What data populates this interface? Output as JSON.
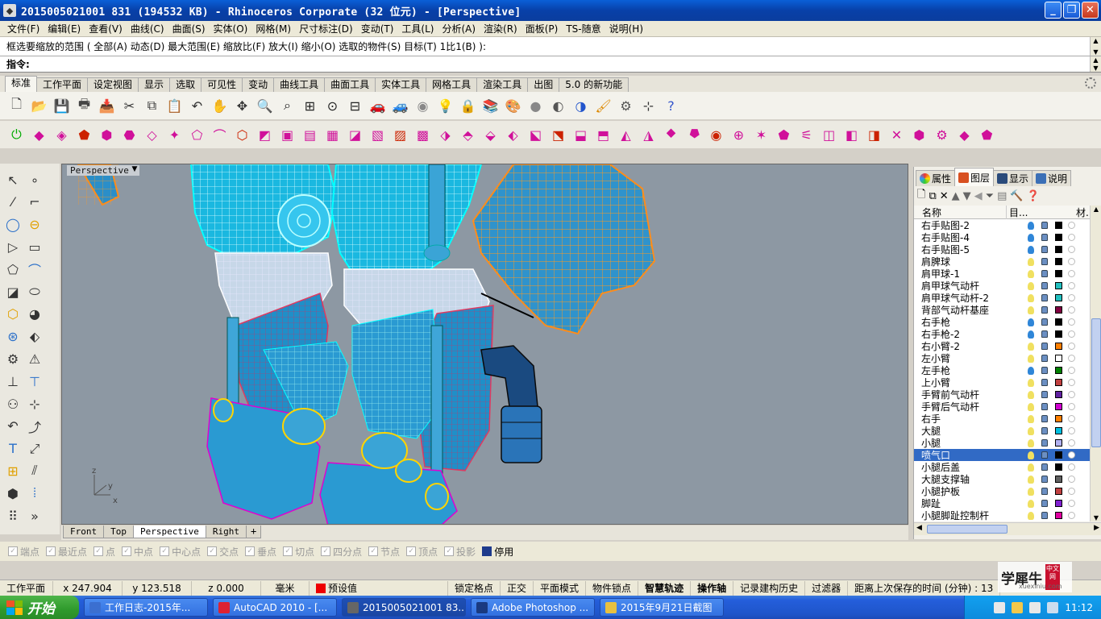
{
  "window": {
    "title": "2015005021001 831 (194532 KB) - Rhinoceros Corporate (32 位元) - [Perspective]",
    "buttons": [
      "_",
      "❐",
      "✕"
    ]
  },
  "menu": [
    "文件(F)",
    "编辑(E)",
    "查看(V)",
    "曲线(C)",
    "曲面(S)",
    "实体(O)",
    "网格(M)",
    "尺寸标注(D)",
    "变动(T)",
    "工具(L)",
    "分析(A)",
    "渲染(R)",
    "面板(P)",
    "TS-随意",
    "说明(H)"
  ],
  "command": {
    "history": "框选要缩放的范围 ( 全部(A)  动态(D)  最大范围(E)  缩放比(F)  放大(I)  缩小(O)  选取的物件(S)  目标(T)  1比1(B) ):",
    "prompt": "指令:",
    "value": ""
  },
  "toolbar_tabs": [
    "标准",
    "工作平面",
    "设定视图",
    "显示",
    "选取",
    "可见性",
    "变动",
    "曲线工具",
    "曲面工具",
    "实体工具",
    "网格工具",
    "渲染工具",
    "出图",
    "5.0 的新功能"
  ],
  "toolbar_tabs_active": 0,
  "toolbar_row1_icons": [
    "new-icon",
    "open-icon",
    "save-icon",
    "print-icon",
    "import-icon",
    "cut-icon",
    "copy-icon",
    "paste-icon",
    "undo-icon",
    "pan-icon",
    "rotate-view-icon",
    "zoom-icon",
    "zoom-window-icon",
    "zoom-extents-icon",
    "zoom-selected-icon",
    "viewports-icon",
    "car-icon",
    "car-ghost-icon",
    "cplane-icon",
    "light-icon",
    "lock-icon",
    "layer-icon",
    "color-wheel-icon",
    "shade-icon",
    "render-icon",
    "material-icon",
    "select-icon",
    "options-icon",
    "snap-icon",
    "help-icon"
  ],
  "toolbar_row2_count": 44,
  "left_toolbar_count": 32,
  "viewport": {
    "label": "Perspective",
    "axis_labels": [
      "z",
      "y",
      "x"
    ],
    "tabs": [
      "Front",
      "Top",
      "Perspective",
      "Right",
      "+"
    ],
    "active_tab": 2
  },
  "panel": {
    "tabs": [
      "属性",
      "图层",
      "显示",
      "说明"
    ],
    "active_tab": 1,
    "columns": [
      "名称",
      "目...",
      "材..."
    ],
    "layers": [
      {
        "name": "右手贴图-2",
        "color": "#000000",
        "bulb": "#2f86d8"
      },
      {
        "name": "右手贴图-4",
        "color": "#000000",
        "bulb": "#2f86d8"
      },
      {
        "name": "右手贴图-5",
        "color": "#000000",
        "bulb": "#2f86d8"
      },
      {
        "name": "肩脾球",
        "color": "#000000",
        "bulb": "#f0e060"
      },
      {
        "name": "肩甲球-1",
        "color": "#000000",
        "bulb": "#f0e060"
      },
      {
        "name": "肩甲球气动杆",
        "color": "#22c0c0",
        "bulb": "#f0e060"
      },
      {
        "name": "肩甲球气动杆-2",
        "color": "#22c0c0",
        "bulb": "#f0e060"
      },
      {
        "name": "背部气动杆基座",
        "color": "#800040",
        "bulb": "#f0e060"
      },
      {
        "name": "右手枪",
        "color": "#000000",
        "bulb": "#2f86d8"
      },
      {
        "name": "右手枪-2",
        "color": "#000000",
        "bulb": "#2f86d8"
      },
      {
        "name": "右小臂-2",
        "color": "#ff8000",
        "bulb": "#f0e060"
      },
      {
        "name": "左小臂",
        "color": "#ffffff",
        "bulb": "#f0e060"
      },
      {
        "name": "左手枪",
        "color": "#008000",
        "bulb": "#2f86d8"
      },
      {
        "name": "上小臂",
        "color": "#c04040",
        "bulb": "#f0e060"
      },
      {
        "name": "手臂前气动杆",
        "color": "#6020a0",
        "bulb": "#f0e060"
      },
      {
        "name": "手臂后气动杆",
        "color": "#d000d0",
        "bulb": "#f0e060"
      },
      {
        "name": "右手",
        "color": "#ff8000",
        "bulb": "#f0e060"
      },
      {
        "name": "大腿",
        "color": "#00c0e0",
        "bulb": "#f0e060"
      },
      {
        "name": "小腿",
        "color": "#b0b0f0",
        "bulb": "#f0e060"
      },
      {
        "name": "喷气口",
        "color": "#000000",
        "bulb": "#f0e060",
        "selected": true
      },
      {
        "name": "小腿后盖",
        "color": "#000000",
        "bulb": "#f0e060"
      },
      {
        "name": "大腿支撑轴",
        "color": "#606060",
        "bulb": "#f0e060"
      },
      {
        "name": "小腿护板",
        "color": "#c04040",
        "bulb": "#f0e060"
      },
      {
        "name": "脚趾",
        "color": "#8020d0",
        "bulb": "#f0e060"
      },
      {
        "name": "小腿脚趾控制杆",
        "color": "#e000a0",
        "bulb": "#f0e060"
      }
    ]
  },
  "osnap": [
    {
      "label": "端点",
      "on": false
    },
    {
      "label": "最近点",
      "on": false
    },
    {
      "label": "点",
      "on": false
    },
    {
      "label": "中点",
      "on": false
    },
    {
      "label": "中心点",
      "on": false
    },
    {
      "label": "交点",
      "on": false
    },
    {
      "label": "垂点",
      "on": false
    },
    {
      "label": "切点",
      "on": false
    },
    {
      "label": "四分点",
      "on": false
    },
    {
      "label": "节点",
      "on": false
    },
    {
      "label": "顶点",
      "on": false
    },
    {
      "label": "投影",
      "on": false
    },
    {
      "label": "停用",
      "on": true
    }
  ],
  "status": {
    "cplane": "工作平面",
    "x": "x 247.904",
    "y": "y 123.518",
    "z": "z 0.000",
    "unit": "毫米",
    "layer": "预设值",
    "items": [
      "锁定格点",
      "正交",
      "平面模式",
      "物件锁点",
      "智慧轨迹",
      "操作轴",
      "记录建构历史",
      "过滤器",
      "距离上次保存的时间 (分钟) : 13"
    ],
    "bold_items": [
      "智慧轨迹",
      "操作轴"
    ]
  },
  "watermark": {
    "text": "学犀牛",
    "badge": "中文网",
    "url": "xuexiniu.com"
  },
  "taskbar": {
    "start": "开始",
    "tasks": [
      {
        "label": "工作日志-2015年...",
        "color": "#3b6fd0"
      },
      {
        "label": "AutoCAD 2010 - [...",
        "color": "#d23"
      },
      {
        "label": "2015005021001 83...",
        "color": "#666",
        "active": true
      },
      {
        "label": "Adobe Photoshop ...",
        "color": "#1a3a80"
      },
      {
        "label": "2015年9月21日截图",
        "color": "#e8c040"
      }
    ],
    "clock": "11:12"
  }
}
